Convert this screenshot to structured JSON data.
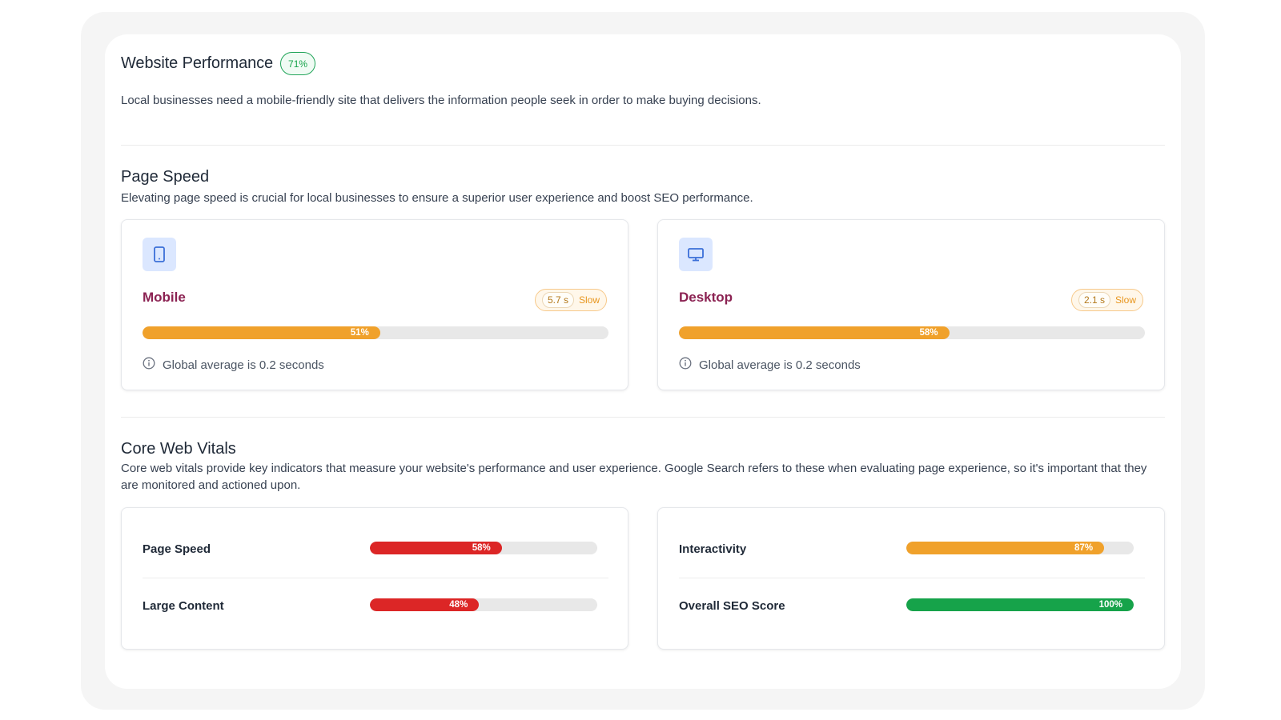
{
  "header": {
    "title": "Website Performance",
    "score_badge": "71%",
    "description": "Local businesses need a mobile-friendly site that delivers the information people seek in order to make buying decisions."
  },
  "page_speed": {
    "title": "Page Speed",
    "description": "Elevating page speed is crucial for local businesses to ensure a superior user experience and boost SEO performance.",
    "cards": [
      {
        "label": "Mobile",
        "icon": "mobile-phone-icon",
        "time": "5.7 s",
        "status": "Slow",
        "progress_label": "51%",
        "progress": 0.51,
        "color": "#f0a12b",
        "info": "Global average is 0.2 seconds"
      },
      {
        "label": "Desktop",
        "icon": "desktop-monitor-icon",
        "time": "2.1 s",
        "status": "Slow",
        "progress_label": "58%",
        "progress": 0.58,
        "color": "#f0a12b",
        "info": "Global average is 0.2 seconds"
      }
    ]
  },
  "core_web_vitals": {
    "title": "Core Web Vitals",
    "description": "Core web vitals provide key indicators that measure your website's performance and user experience. Google Search refers to these when evaluating page experience, so it's important that they are monitored and actioned upon.",
    "metrics": [
      {
        "label": "Page Speed",
        "progress_label": "58%",
        "progress": 0.58,
        "color": "#dc2626"
      },
      {
        "label": "Large Content",
        "progress_label": "48%",
        "progress": 0.48,
        "color": "#dc2626"
      },
      {
        "label": "Interactivity",
        "progress_label": "87%",
        "progress": 0.87,
        "color": "#f0a12b"
      },
      {
        "label": "Overall SEO Score",
        "progress_label": "100%",
        "progress": 1.0,
        "color": "#16a34a"
      }
    ]
  },
  "colors": {
    "accent_label": "#8b2252",
    "track": "#e8e8e8",
    "badge_green": "#16a34a",
    "badge_orange": "#e8961f"
  }
}
